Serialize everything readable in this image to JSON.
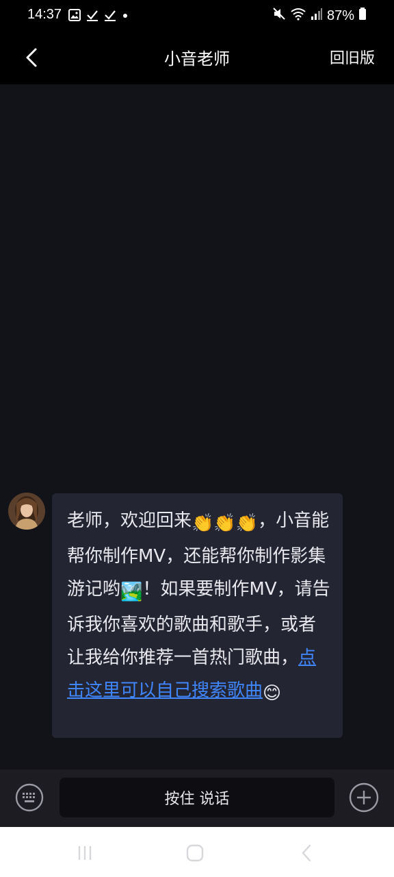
{
  "status_bar": {
    "time": "14:37",
    "battery": "87%",
    "left_icons": [
      "image-icon",
      "check-icon",
      "check-icon",
      "dot-icon"
    ],
    "right_icons": [
      "mute-icon",
      "wifi-icon",
      "signal-icon",
      "battery-icon"
    ]
  },
  "header": {
    "title": "小音老师",
    "right_link": "回旧版"
  },
  "message": {
    "text_1": "老师，欢迎回来",
    "emoji_clap": "👏",
    "text_2": "，小音能帮你制作MV，还能帮你制作影集游记哟",
    "emoji_landscape": "🏞️",
    "text_3": "！如果要制作MV，请告诉我你喜欢的歌曲和歌手，或者让我给你推荐一首热门歌曲，",
    "link_text": "点击这里可以自己搜索歌曲",
    "emoji_smile": "😊"
  },
  "input_bar": {
    "hold_to_talk_label": "按住 说话"
  },
  "colors": {
    "chat_background": "#121219",
    "bubble_background": "#242532",
    "link": "#3f86ff",
    "input_bar": "#1c1c22"
  }
}
